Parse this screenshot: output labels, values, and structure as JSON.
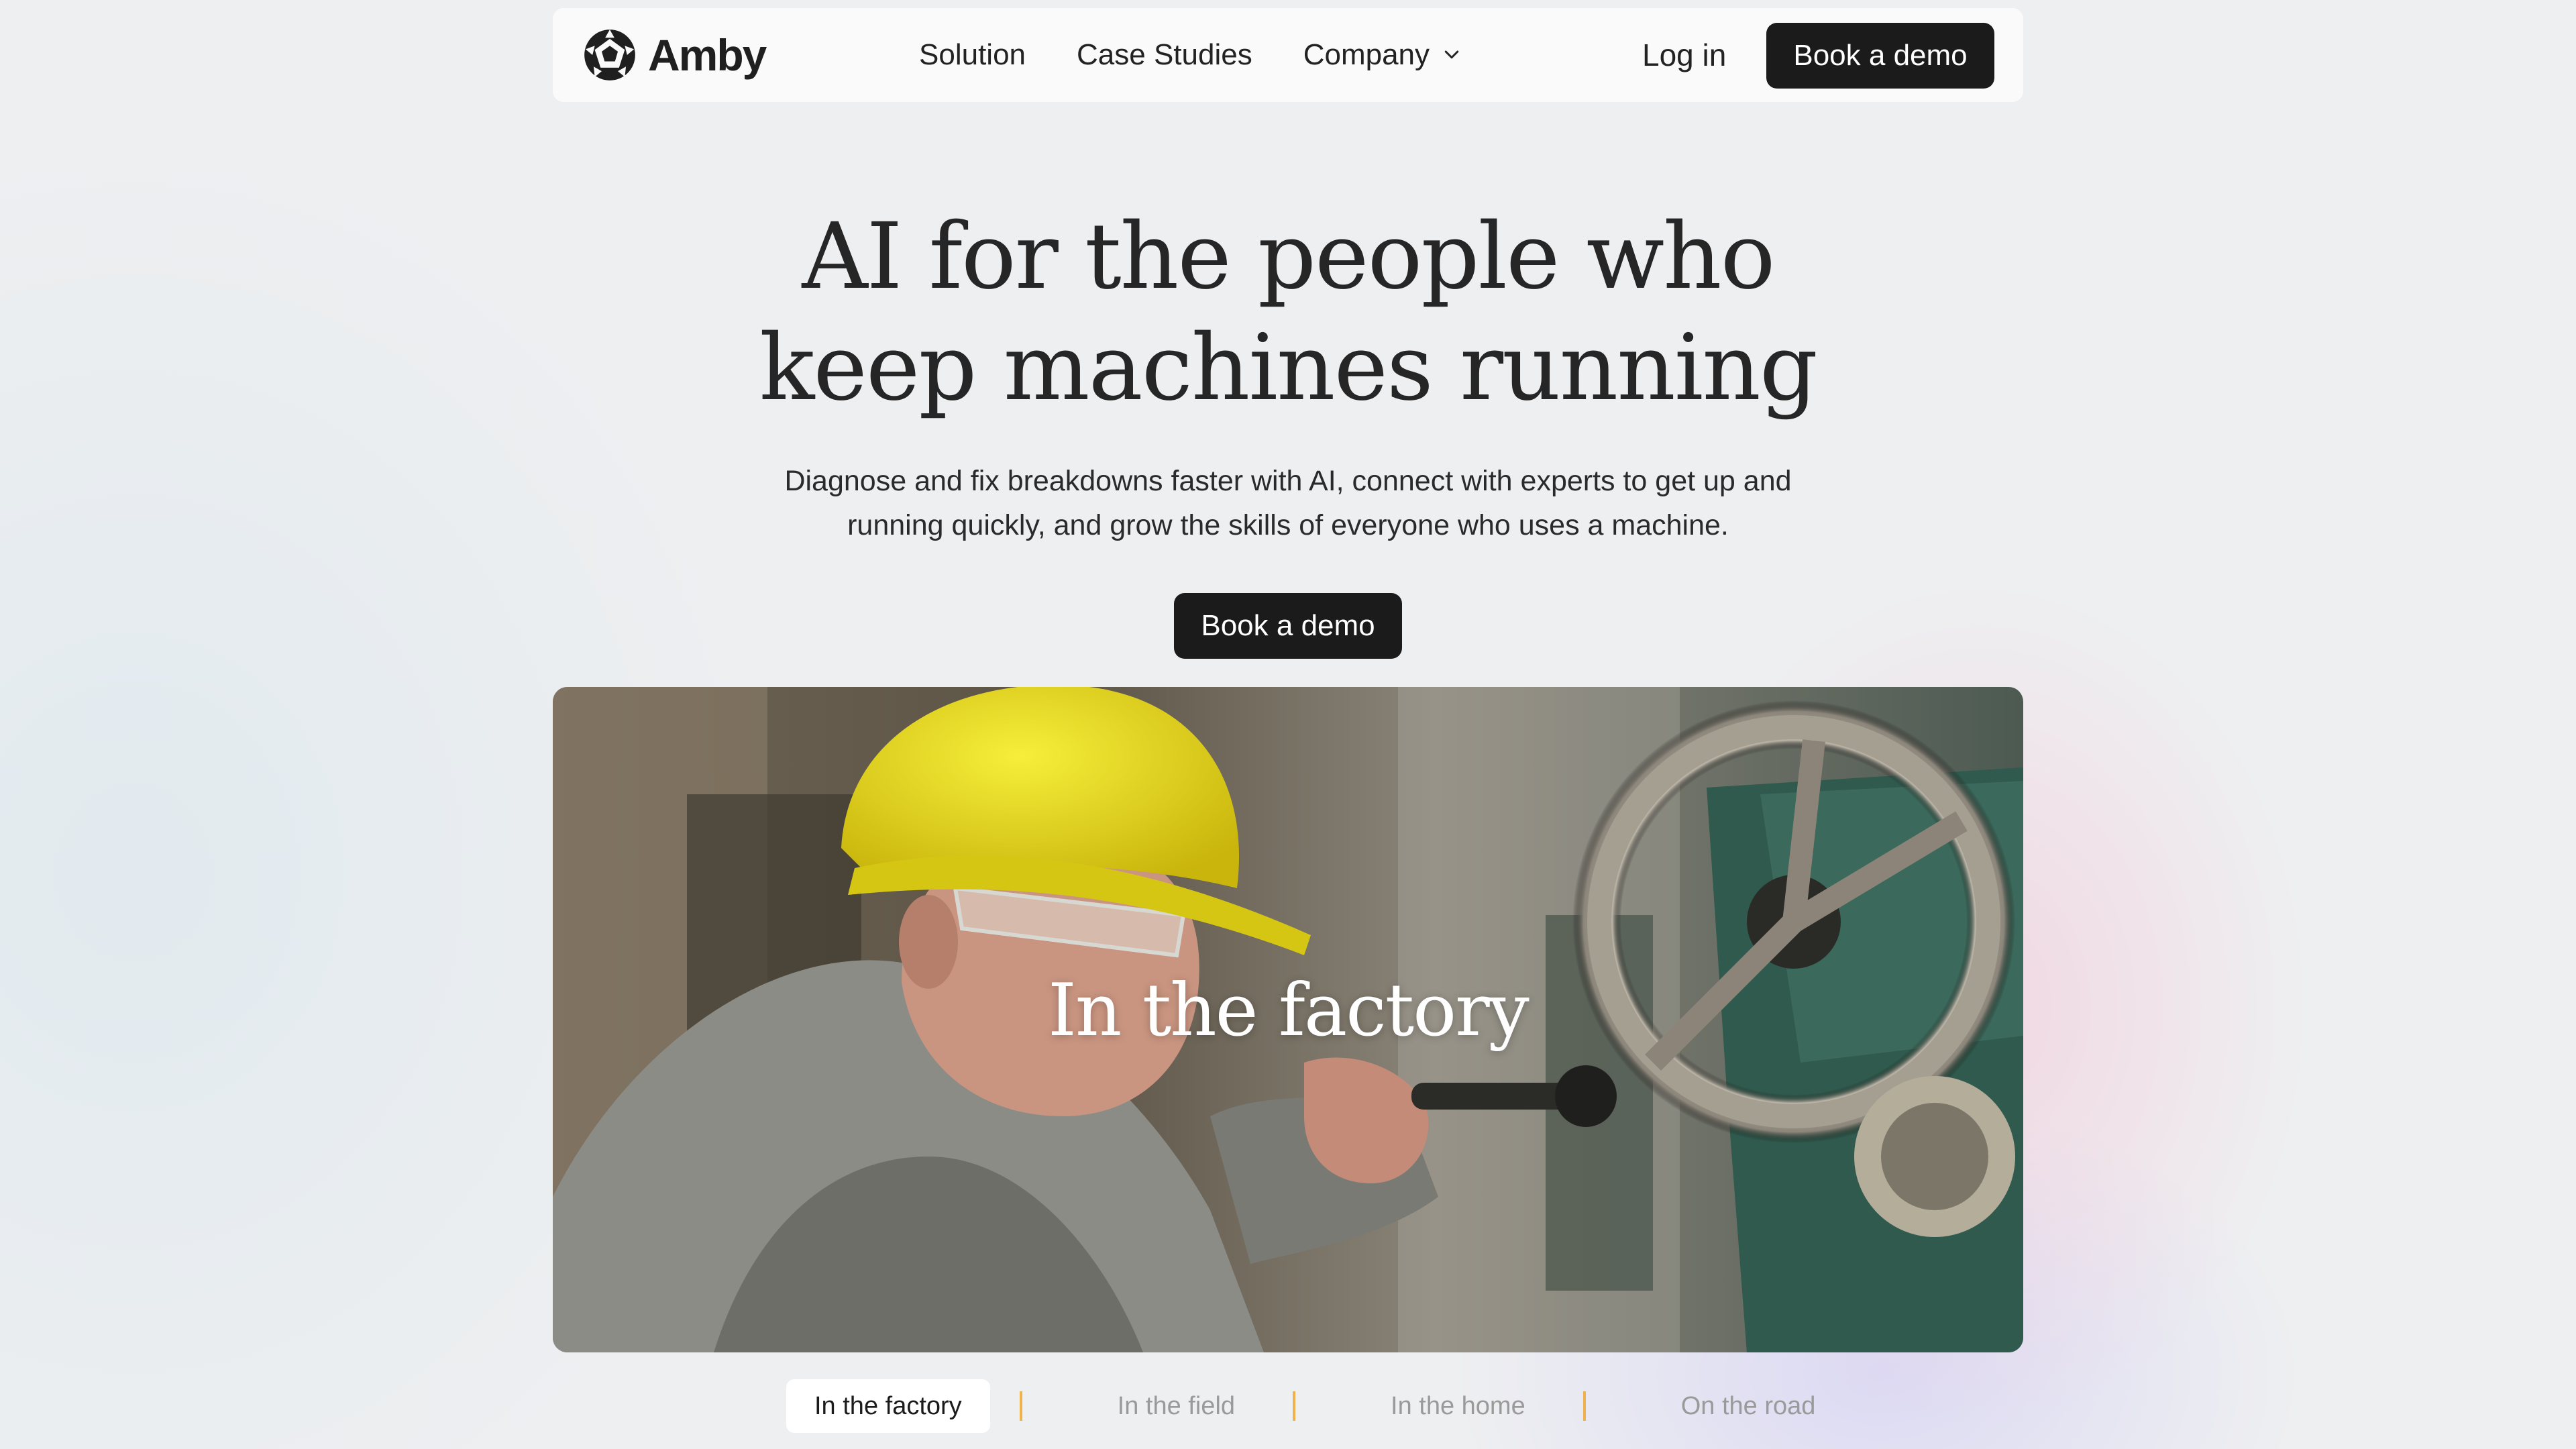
{
  "brand": {
    "name": "Amby"
  },
  "nav": {
    "links": [
      {
        "label": "Solution"
      },
      {
        "label": "Case Studies"
      },
      {
        "label": "Company"
      }
    ],
    "login_label": "Log in",
    "cta_label": "Book a demo"
  },
  "hero": {
    "title_line1": "AI for the people who",
    "title_line2": "keep machines running",
    "subtitle_line1": "Diagnose and fix breakdowns faster with AI, connect with experts to get up and",
    "subtitle_line2": "running quickly, and grow the skills of everyone who uses a machine.",
    "cta_label": "Book a demo"
  },
  "media": {
    "caption": "In the factory"
  },
  "tabs": [
    {
      "label": "In the factory",
      "active": true
    },
    {
      "label": "In the field",
      "active": false
    },
    {
      "label": "In the home",
      "active": false
    },
    {
      "label": "On the road",
      "active": false
    }
  ],
  "colors": {
    "accent_dark": "#1b1b1b",
    "tab_separator": "#f0b24d",
    "background": "#eeeff1"
  }
}
